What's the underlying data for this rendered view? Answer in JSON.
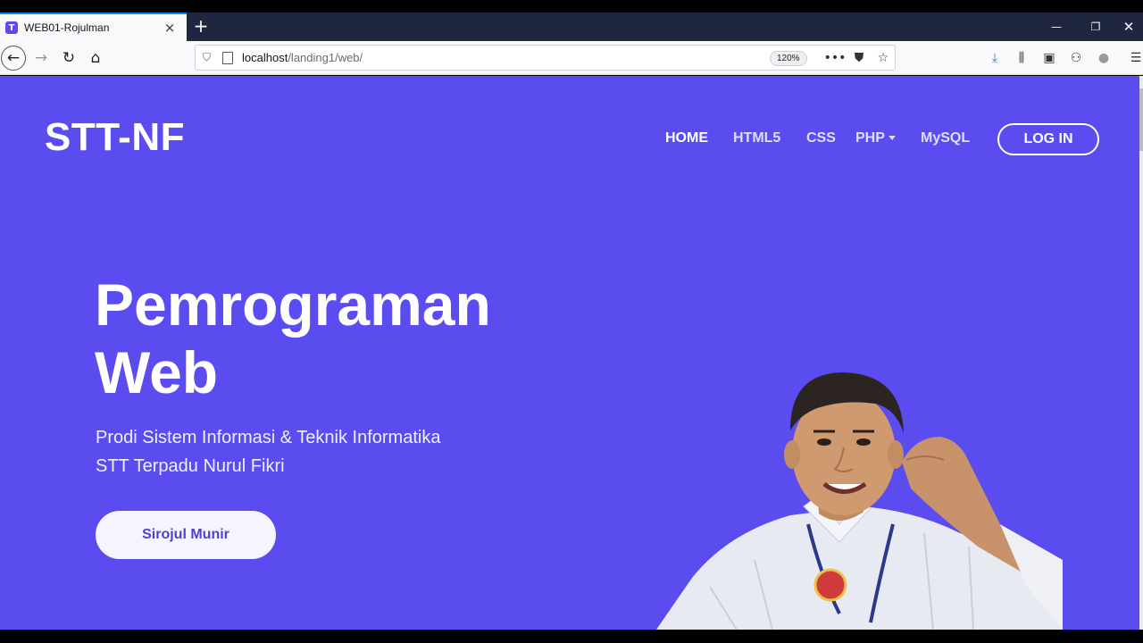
{
  "browser": {
    "tab_favicon": "T",
    "tab_title": "WEB01-Rojulman",
    "url_host": "localhost",
    "url_path": "/landing1/web/",
    "zoom": "120%"
  },
  "site": {
    "brand": "STT-NF",
    "nav": {
      "home": "HOME",
      "html5": "HTML5",
      "css": "CSS",
      "php": "PHP",
      "mysql": "MySQL",
      "login": "LOG IN"
    },
    "hero": {
      "title_line1": "Pemrograman",
      "title_line2": "Web",
      "sub_line1": "Prodi Sistem Informasi & Teknik Informatika",
      "sub_line2": "STT Terpadu Nurul Fikri",
      "button": "Sirojul Munir"
    },
    "colors": {
      "background": "#5a4cef",
      "button_text": "#4c3fd8"
    }
  }
}
